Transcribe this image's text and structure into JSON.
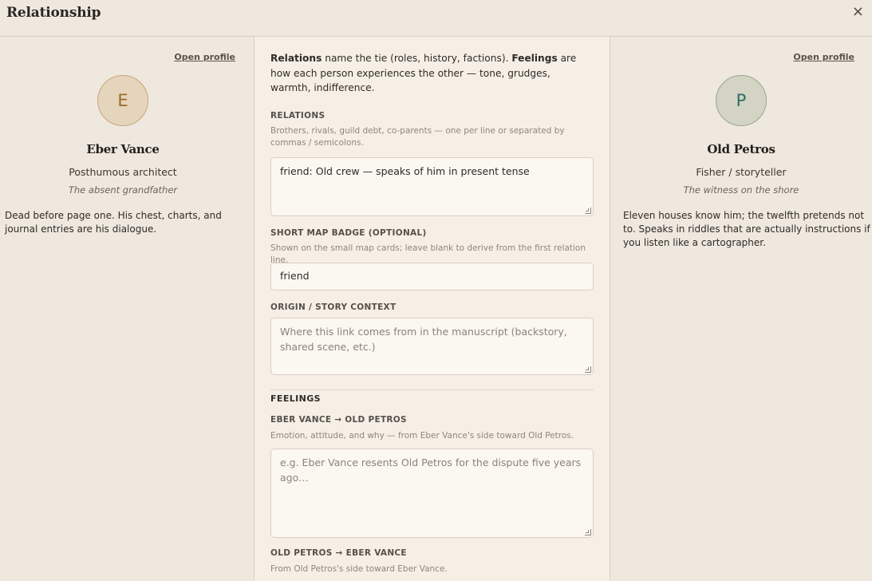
{
  "header": {
    "title": "Relationship",
    "close_glyph": "×"
  },
  "left_person": {
    "open_profile_label": "Open profile",
    "initial": "E",
    "name": "Eber Vance",
    "role": "Posthumous architect",
    "tagline": "The absent grandfather",
    "description": "Dead before page one. His chest, charts, and journal entries are his dialogue.",
    "avatar_color": "#e6d5bd"
  },
  "right_person": {
    "open_profile_label": "Open profile",
    "initial": "P",
    "name": "Old Petros",
    "role": "Fisher / storyteller",
    "tagline": "The witness on the shore",
    "description": "Eleven houses know him; the twelfth pretends not to. Speaks in riddles that are actually instructions if you listen like a cartographer.",
    "avatar_color": "#d3d4c3"
  },
  "intro": {
    "relations_word": "Relations",
    "relations_text": " name the tie (roles, history, factions). ",
    "feelings_word": "Feelings",
    "feelings_text": " are how each person experiences the other — tone, grudges, warmth, indifference."
  },
  "relations": {
    "label": "RELATIONS",
    "help": "Brothers, rivals, guild debt, co-parents — one per line or separated by commas / semicolons.",
    "value": "friend: Old crew — speaks of him in present tense"
  },
  "badge": {
    "label": "SHORT MAP BADGE (OPTIONAL)",
    "help": "Shown on the small map cards; leave blank to derive from the first relation line.",
    "value": "friend"
  },
  "origin": {
    "label": "ORIGIN / STORY CONTEXT",
    "placeholder": "Where this link comes from in the manuscript (backstory, shared scene, etc.)"
  },
  "feelings": {
    "heading": "FEELINGS",
    "a_to_b": {
      "label": "EBER VANCE → OLD PETROS",
      "help": "Emotion, attitude, and why — from Eber Vance's side toward Old Petros.",
      "placeholder": "e.g. Eber Vance resents Old Petros for the dispute five years ago…"
    },
    "b_to_a": {
      "label": "OLD PETROS → EBER VANCE",
      "help": "From Old Petros's side toward Eber Vance."
    }
  },
  "colors": {
    "background": "#efe8df",
    "panel": "#f6efe6",
    "accent_left": "#9a6a2c",
    "accent_right": "#2f6d67"
  }
}
